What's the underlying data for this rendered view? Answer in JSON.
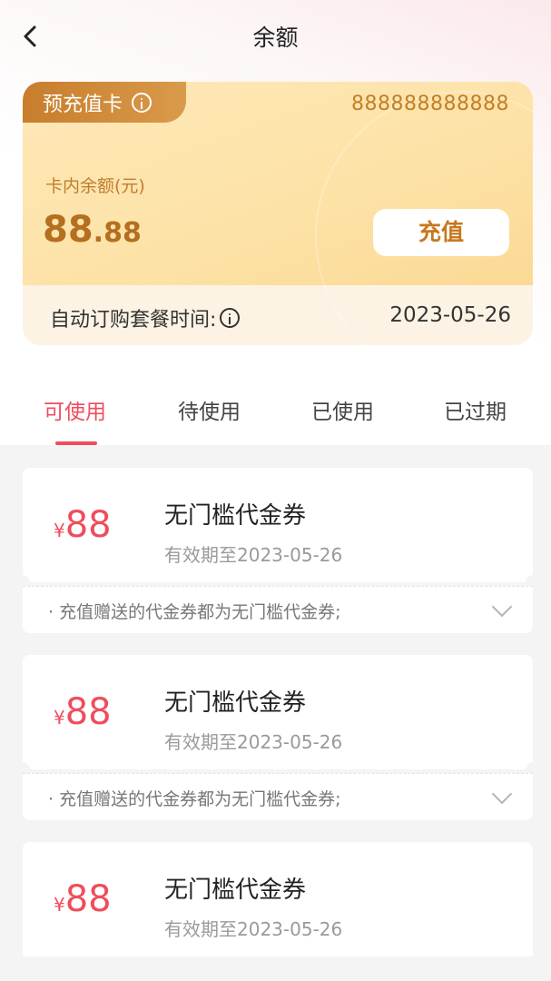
{
  "header": {
    "title": "余额"
  },
  "card": {
    "tag_label": "预充值卡",
    "number": "888888888888",
    "balance_label": "卡内余额(元)",
    "balance_int": "88",
    "balance_dec": ".88",
    "recharge_label": "充值",
    "auto_label": "自动订购套餐时间:",
    "auto_date": "2023-05-26"
  },
  "tabs": [
    {
      "label": "可使用",
      "active": true
    },
    {
      "label": "待使用",
      "active": false
    },
    {
      "label": "已使用",
      "active": false
    },
    {
      "label": "已过期",
      "active": false
    }
  ],
  "coupons": [
    {
      "symbol": "¥",
      "value": "88",
      "title": "无门槛代金券",
      "expiry": "有效期至2023-05-26",
      "note": "· 充值赠送的代金券都为无门槛代金券;"
    },
    {
      "symbol": "¥",
      "value": "88",
      "title": "无门槛代金券",
      "expiry": "有效期至2023-05-26",
      "note": "· 充值赠送的代金券都为无门槛代金券;"
    },
    {
      "symbol": "¥",
      "value": "88",
      "title": "无门槛代金券",
      "expiry": "有效期至2023-05-26",
      "note": ""
    }
  ],
  "colors": {
    "accent": "#ef4d5c",
    "gold": "#c7771f",
    "card_bg": "#fde2a6"
  },
  "icons": {
    "back": "chevron-left-icon",
    "info": "info-icon",
    "expand": "chevron-down-icon"
  }
}
